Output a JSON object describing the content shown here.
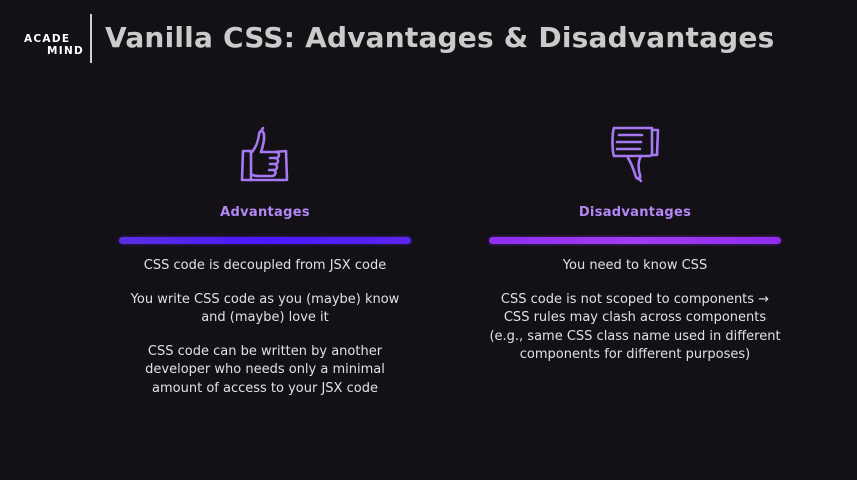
{
  "logo": {
    "line1": "ACADE",
    "line2": "MIND"
  },
  "title": "Vanilla CSS: Advantages & Disadvantages",
  "advantages": {
    "heading": "Advantages",
    "icon": "thumbs-up-icon",
    "points": [
      "CSS code is decoupled from JSX code",
      "You write CSS code as you (maybe) know and (maybe) love it",
      "CSS code can be written by another developer who needs only a minimal amount of access to your JSX code"
    ]
  },
  "disadvantages": {
    "heading": "Disadvantages",
    "icon": "thumbs-down-icon",
    "points": [
      "You need to know CSS",
      "CSS code is not scoped to components → CSS rules may clash across components (e.g., same CSS class name used in different components for different purposes)"
    ]
  },
  "colors": {
    "background": "#131116",
    "title": "#cbcbcb",
    "heading": "#b487f6",
    "icon_stroke": "#a678f2",
    "advantages_bar": "#4b17ff",
    "disadvantages_bar": "#a23bf4",
    "logo_accent": "#f2a23c"
  }
}
